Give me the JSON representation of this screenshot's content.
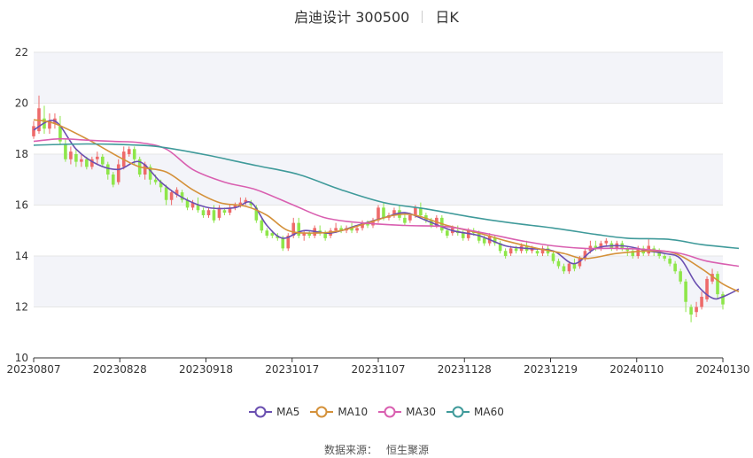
{
  "title": {
    "name": "启迪设计 300500",
    "period": "日K"
  },
  "source": {
    "label": "数据来源：",
    "value": "恒生聚源"
  },
  "colors": {
    "up": "#ee6a6a",
    "down": "#8ee64a",
    "ma5": "#6a4fb0",
    "ma10": "#d4913a",
    "ma30": "#d95fb0",
    "ma60": "#3f9a9a",
    "band": "#f3f4f9",
    "grid": "#e6e6e6"
  },
  "chart_data": {
    "type": "candlestick",
    "y_axis": {
      "min": 10,
      "max": 22,
      "ticks": [
        10,
        12,
        14,
        16,
        18,
        20,
        22
      ]
    },
    "x_labels": [
      "20230807",
      "20230828",
      "20230918",
      "20231017",
      "20231107",
      "20231128",
      "20231219",
      "20240110",
      "20240130"
    ],
    "legend": [
      "MA5",
      "MA10",
      "MA30",
      "MA60"
    ],
    "candles": [
      [
        18.7,
        19.1,
        19.3,
        18.6
      ],
      [
        18.9,
        19.8,
        20.3,
        18.8
      ],
      [
        19.4,
        19.0,
        19.9,
        18.8
      ],
      [
        19.0,
        19.3,
        19.6,
        18.8
      ],
      [
        19.2,
        19.4,
        19.6,
        19.0
      ],
      [
        19.1,
        18.5,
        19.5,
        18.4
      ],
      [
        18.4,
        17.8,
        18.6,
        17.7
      ],
      [
        17.8,
        18.1,
        18.3,
        17.6
      ],
      [
        18.0,
        17.7,
        18.2,
        17.5
      ],
      [
        17.7,
        17.8,
        18.0,
        17.5
      ],
      [
        17.8,
        17.5,
        17.9,
        17.4
      ],
      [
        17.5,
        17.8,
        17.9,
        17.4
      ],
      [
        17.8,
        17.9,
        18.1,
        17.6
      ],
      [
        17.9,
        17.6,
        18.0,
        17.5
      ],
      [
        17.6,
        17.2,
        17.7,
        17.0
      ],
      [
        17.2,
        16.8,
        17.3,
        16.7
      ],
      [
        16.9,
        17.6,
        17.8,
        16.8
      ],
      [
        17.5,
        18.1,
        18.3,
        17.4
      ],
      [
        18.0,
        18.2,
        18.3,
        17.9
      ],
      [
        18.2,
        17.8,
        18.3,
        17.6
      ],
      [
        17.8,
        17.2,
        17.9,
        17.1
      ],
      [
        17.2,
        17.6,
        17.7,
        17.0
      ],
      [
        17.5,
        17.0,
        17.6,
        16.8
      ],
      [
        17.0,
        16.9,
        17.2,
        16.8
      ],
      [
        16.9,
        16.7,
        17.0,
        16.5
      ],
      [
        16.7,
        16.2,
        16.8,
        16.0
      ],
      [
        16.2,
        16.5,
        16.6,
        16.0
      ],
      [
        16.4,
        16.6,
        16.7,
        16.3
      ],
      [
        16.5,
        16.2,
        16.6,
        16.1
      ],
      [
        16.2,
        15.9,
        16.3,
        15.8
      ],
      [
        15.9,
        16.1,
        16.2,
        15.8
      ],
      [
        16.0,
        15.8,
        16.3,
        15.7
      ],
      [
        15.8,
        15.6,
        15.9,
        15.5
      ],
      [
        15.6,
        15.8,
        15.9,
        15.5
      ],
      [
        15.8,
        15.4,
        16.0,
        15.3
      ],
      [
        15.5,
        15.9,
        16.0,
        15.4
      ],
      [
        15.8,
        15.7,
        15.9,
        15.6
      ],
      [
        15.7,
        15.9,
        16.0,
        15.6
      ],
      [
        15.9,
        16.0,
        16.1,
        15.8
      ],
      [
        16.0,
        16.1,
        16.3,
        15.9
      ],
      [
        16.1,
        16.2,
        16.3,
        16.0
      ],
      [
        16.1,
        16.0,
        16.2,
        15.9
      ],
      [
        15.9,
        15.4,
        16.0,
        15.3
      ],
      [
        15.4,
        15.0,
        15.5,
        14.9
      ],
      [
        15.0,
        14.8,
        15.1,
        14.7
      ],
      [
        14.9,
        14.8,
        15.0,
        14.7
      ],
      [
        14.8,
        14.7,
        14.9,
        14.6
      ],
      [
        14.7,
        14.3,
        14.8,
        14.2
      ],
      [
        14.3,
        14.8,
        14.9,
        14.2
      ],
      [
        14.8,
        15.3,
        15.5,
        14.7
      ],
      [
        15.3,
        14.8,
        15.5,
        14.7
      ],
      [
        14.8,
        14.9,
        15.0,
        14.6
      ],
      [
        14.9,
        14.8,
        15.0,
        14.7
      ],
      [
        14.8,
        15.1,
        15.2,
        14.7
      ],
      [
        15.0,
        14.9,
        15.2,
        14.8
      ],
      [
        14.9,
        14.7,
        15.0,
        14.6
      ],
      [
        14.8,
        15.0,
        15.1,
        14.7
      ],
      [
        15.0,
        15.1,
        15.3,
        14.9
      ],
      [
        15.1,
        15.0,
        15.2,
        14.9
      ],
      [
        15.0,
        15.1,
        15.2,
        14.9
      ],
      [
        15.1,
        15.0,
        15.3,
        14.9
      ],
      [
        15.0,
        15.1,
        15.2,
        14.9
      ],
      [
        15.1,
        15.3,
        15.4,
        15.0
      ],
      [
        15.3,
        15.2,
        15.4,
        15.1
      ],
      [
        15.2,
        15.4,
        15.5,
        15.1
      ],
      [
        15.4,
        15.9,
        16.0,
        15.3
      ],
      [
        15.9,
        15.5,
        16.1,
        15.4
      ],
      [
        15.5,
        15.6,
        15.7,
        15.4
      ],
      [
        15.6,
        15.8,
        15.9,
        15.5
      ],
      [
        15.8,
        15.5,
        16.0,
        15.4
      ],
      [
        15.5,
        15.3,
        15.7,
        15.2
      ],
      [
        15.4,
        15.6,
        15.7,
        15.3
      ],
      [
        15.6,
        15.9,
        16.0,
        15.5
      ],
      [
        15.9,
        15.6,
        16.1,
        15.5
      ],
      [
        15.6,
        15.4,
        15.7,
        15.3
      ],
      [
        15.4,
        15.2,
        15.5,
        15.1
      ],
      [
        15.2,
        15.5,
        15.6,
        15.1
      ],
      [
        15.5,
        15.0,
        15.6,
        14.9
      ],
      [
        15.0,
        14.8,
        15.1,
        14.7
      ],
      [
        14.9,
        15.1,
        15.2,
        14.8
      ],
      [
        15.0,
        14.9,
        15.2,
        14.8
      ],
      [
        14.9,
        14.7,
        15.0,
        14.6
      ],
      [
        14.7,
        15.0,
        15.1,
        14.6
      ],
      [
        15.0,
        14.9,
        15.1,
        14.8
      ],
      [
        14.9,
        14.6,
        15.0,
        14.5
      ],
      [
        14.7,
        14.5,
        14.8,
        14.4
      ],
      [
        14.5,
        14.8,
        14.9,
        14.4
      ],
      [
        14.7,
        14.5,
        14.8,
        14.4
      ],
      [
        14.5,
        14.2,
        14.6,
        14.1
      ],
      [
        14.2,
        14.0,
        14.3,
        13.9
      ],
      [
        14.1,
        14.3,
        14.4,
        14.0
      ],
      [
        14.3,
        14.2,
        14.4,
        14.1
      ],
      [
        14.2,
        14.4,
        14.5,
        14.1
      ],
      [
        14.4,
        14.2,
        14.6,
        14.1
      ],
      [
        14.2,
        14.3,
        14.4,
        14.1
      ],
      [
        14.2,
        14.1,
        14.3,
        14.0
      ],
      [
        14.1,
        14.3,
        14.4,
        14.0
      ],
      [
        14.3,
        14.1,
        14.4,
        14.0
      ],
      [
        14.1,
        13.8,
        14.2,
        13.7
      ],
      [
        13.8,
        13.6,
        13.9,
        13.5
      ],
      [
        13.6,
        13.4,
        13.7,
        13.3
      ],
      [
        13.4,
        13.7,
        13.8,
        13.3
      ],
      [
        13.7,
        13.5,
        13.9,
        13.4
      ],
      [
        13.6,
        13.9,
        14.0,
        13.5
      ],
      [
        13.9,
        14.2,
        14.3,
        13.8
      ],
      [
        14.2,
        14.4,
        14.6,
        14.1
      ],
      [
        14.4,
        14.3,
        14.6,
        14.2
      ],
      [
        14.3,
        14.5,
        14.6,
        14.2
      ],
      [
        14.5,
        14.6,
        14.7,
        14.4
      ],
      [
        14.5,
        14.3,
        14.6,
        14.2
      ],
      [
        14.3,
        14.5,
        14.6,
        14.2
      ],
      [
        14.5,
        14.3,
        14.6,
        14.2
      ],
      [
        14.3,
        14.2,
        14.4,
        14.0
      ],
      [
        14.2,
        14.0,
        14.3,
        13.9
      ],
      [
        14.0,
        14.3,
        14.4,
        13.9
      ],
      [
        14.3,
        14.1,
        14.4,
        14.0
      ],
      [
        14.1,
        14.4,
        14.7,
        14.0
      ],
      [
        14.3,
        14.2,
        14.4,
        14.0
      ],
      [
        14.2,
        14.0,
        14.3,
        13.9
      ],
      [
        14.0,
        13.9,
        14.1,
        13.8
      ],
      [
        13.9,
        13.7,
        14.0,
        13.6
      ],
      [
        13.7,
        13.4,
        13.8,
        13.3
      ],
      [
        13.4,
        13.0,
        13.5,
        12.9
      ],
      [
        13.0,
        12.2,
        13.1,
        11.8
      ],
      [
        12.0,
        11.7,
        12.1,
        11.4
      ],
      [
        11.8,
        12.0,
        12.2,
        11.6
      ],
      [
        12.0,
        12.4,
        12.6,
        11.9
      ],
      [
        12.3,
        13.1,
        13.2,
        12.2
      ],
      [
        13.0,
        13.3,
        13.5,
        12.9
      ],
      [
        13.3,
        12.5,
        13.4,
        12.3
      ],
      [
        12.5,
        12.1,
        12.6,
        11.9
      ]
    ],
    "ma_anchors": {
      "MA5": [
        [
          0,
          18.95
        ],
        [
          4,
          19.3
        ],
        [
          8,
          18.2
        ],
        [
          12,
          17.6
        ],
        [
          16,
          17.4
        ],
        [
          20,
          17.7
        ],
        [
          24,
          16.9
        ],
        [
          28,
          16.3
        ],
        [
          33,
          15.9
        ],
        [
          38,
          15.9
        ],
        [
          41,
          16.1
        ],
        [
          44,
          15.2
        ],
        [
          47,
          14.7
        ],
        [
          51,
          15.0
        ],
        [
          56,
          14.9
        ],
        [
          61,
          15.2
        ],
        [
          66,
          15.5
        ],
        [
          70,
          15.7
        ],
        [
          74,
          15.4
        ],
        [
          79,
          15.0
        ],
        [
          84,
          14.8
        ],
        [
          89,
          14.4
        ],
        [
          93,
          14.3
        ],
        [
          98,
          14.2
        ],
        [
          102,
          13.7
        ],
        [
          106,
          14.3
        ],
        [
          111,
          14.4
        ],
        [
          116,
          14.2
        ],
        [
          119,
          14.1
        ],
        [
          122,
          13.9
        ],
        [
          125,
          12.9
        ],
        [
          128,
          12.35
        ],
        [
          130,
          12.4
        ],
        [
          133,
          12.7
        ]
      ],
      "MA10": [
        [
          0,
          19.35
        ],
        [
          4,
          19.2
        ],
        [
          10,
          18.6
        ],
        [
          16,
          17.9
        ],
        [
          20,
          17.5
        ],
        [
          25,
          17.3
        ],
        [
          30,
          16.6
        ],
        [
          35,
          16.1
        ],
        [
          40,
          15.95
        ],
        [
          44,
          15.6
        ],
        [
          48,
          15.0
        ],
        [
          53,
          14.9
        ],
        [
          58,
          15.0
        ],
        [
          63,
          15.3
        ],
        [
          68,
          15.6
        ],
        [
          72,
          15.6
        ],
        [
          78,
          15.2
        ],
        [
          84,
          14.9
        ],
        [
          89,
          14.6
        ],
        [
          95,
          14.3
        ],
        [
          100,
          14.1
        ],
        [
          104,
          13.9
        ],
        [
          110,
          14.1
        ],
        [
          116,
          14.2
        ],
        [
          121,
          14.1
        ],
        [
          126,
          13.5
        ],
        [
          130,
          12.9
        ],
        [
          133,
          12.6
        ]
      ],
      "MA30": [
        [
          0,
          18.5
        ],
        [
          5,
          18.6
        ],
        [
          10,
          18.55
        ],
        [
          15,
          18.5
        ],
        [
          20,
          18.45
        ],
        [
          25,
          18.2
        ],
        [
          30,
          17.4
        ],
        [
          36,
          16.9
        ],
        [
          42,
          16.6
        ],
        [
          49,
          16.0
        ],
        [
          55,
          15.5
        ],
        [
          62,
          15.3
        ],
        [
          70,
          15.2
        ],
        [
          78,
          15.15
        ],
        [
          85,
          14.9
        ],
        [
          92,
          14.6
        ],
        [
          98,
          14.4
        ],
        [
          104,
          14.3
        ],
        [
          110,
          14.3
        ],
        [
          116,
          14.25
        ],
        [
          122,
          14.1
        ],
        [
          127,
          13.8
        ],
        [
          133,
          13.6
        ]
      ],
      "MA60": [
        [
          0,
          18.35
        ],
        [
          10,
          18.4
        ],
        [
          20,
          18.35
        ],
        [
          25,
          18.25
        ],
        [
          33,
          17.95
        ],
        [
          42,
          17.55
        ],
        [
          50,
          17.2
        ],
        [
          58,
          16.6
        ],
        [
          66,
          16.1
        ],
        [
          74,
          15.85
        ],
        [
          82,
          15.55
        ],
        [
          90,
          15.3
        ],
        [
          98,
          15.1
        ],
        [
          106,
          14.85
        ],
        [
          112,
          14.7
        ],
        [
          120,
          14.65
        ],
        [
          126,
          14.45
        ],
        [
          133,
          14.3
        ]
      ]
    }
  }
}
